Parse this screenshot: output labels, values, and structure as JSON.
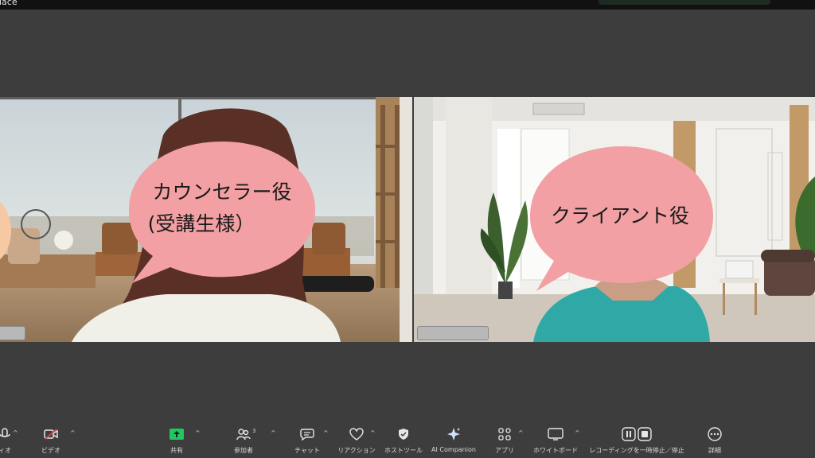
{
  "window": {
    "title_fragment": "place"
  },
  "participants": {
    "left": {
      "bubble_line1": "カウンセラー役",
      "bubble_line2": "(受講生様）"
    },
    "right": {
      "bubble_text": "クライアント役"
    }
  },
  "toolbar": {
    "audio_label": "ィオ",
    "video_label": "ビデオ",
    "share_label": "共有",
    "participants_label": "参加者",
    "participants_count": "3",
    "chat_label": "チャット",
    "reactions_label": "リアクション",
    "host_tools_label": "ホストツール",
    "ai_companion_label": "AI Companion",
    "apps_label": "アプリ",
    "whiteboard_label": "ホワイトボード",
    "recording_label": "レコーディングを一時停止／停止",
    "more_label": "詳細"
  },
  "colors": {
    "share_green": "#22c55e",
    "video_off_red": "#e5484d",
    "bubble_pink": "#f2a0a3"
  }
}
